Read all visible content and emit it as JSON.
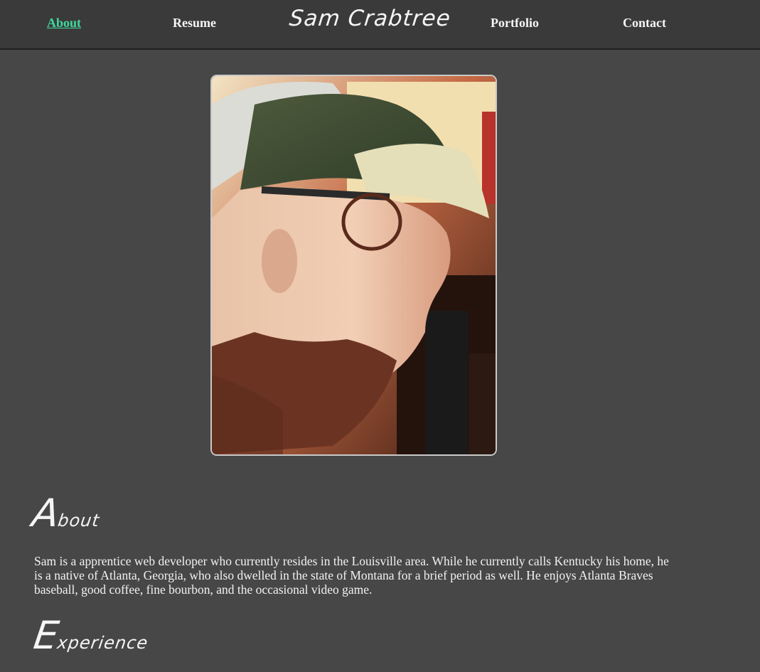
{
  "nav": {
    "about_label": "About",
    "resume_label": "Resume",
    "portfolio_label": "Portfolio",
    "contact_label": "Contact",
    "brand": "Sam Crabtree",
    "active_color": "#3fd9a0"
  },
  "profile_photo": {
    "icon": "portrait-photo"
  },
  "about": {
    "heading_cap": "A",
    "heading_rest": "bout",
    "body": "Sam is a apprentice web developer who currently resides in the Louisville area. While he currently calls Kentucky his home, he is a native of Atlanta, Georgia, who also dwelled in the state of Montana for a brief period as well. He enjoys Atlanta Braves baseball, good coffee, fine bourbon, and the occasional video game."
  },
  "experience": {
    "heading_cap": "E",
    "heading_rest": "xperience"
  },
  "colors": {
    "background": "#474747",
    "navbar": "#3a3a3a",
    "text": "#f2f2f2"
  }
}
